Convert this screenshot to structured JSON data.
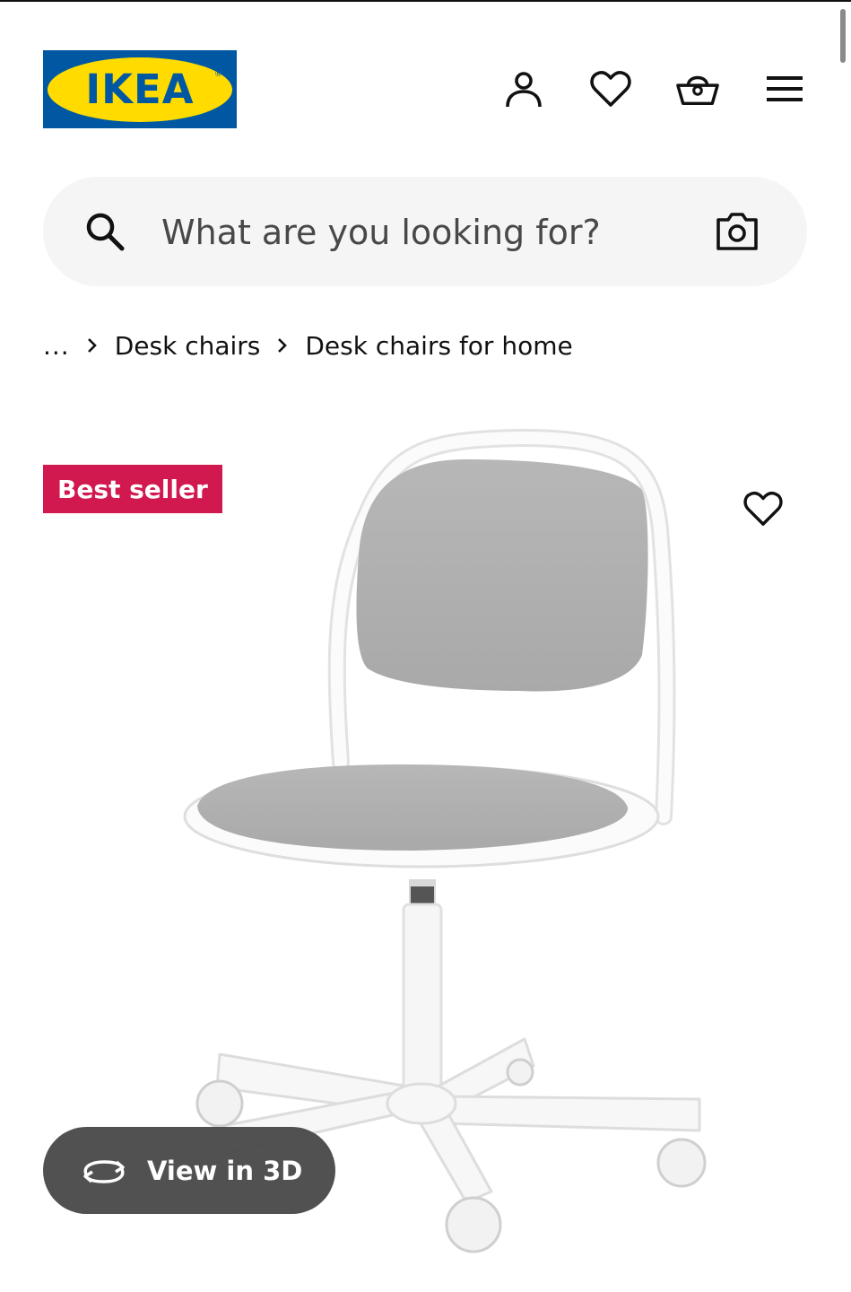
{
  "brand": {
    "logo_text": "IKEA",
    "colors": {
      "blue": "#0058a3",
      "yellow": "#ffdb00",
      "badge": "#d1184f"
    }
  },
  "header": {
    "icons": [
      "account-icon",
      "heart-icon",
      "shopping-basket-icon",
      "menu-icon"
    ]
  },
  "search": {
    "placeholder": "What are you looking for?",
    "icon": "search-icon",
    "camera_icon": "camera-icon"
  },
  "breadcrumb": {
    "items": [
      "...",
      "Desk chairs",
      "Desk chairs for home"
    ]
  },
  "product": {
    "badge": "Best seller",
    "image_alt": "White swivel desk chair with light grey seat and back",
    "view_3d_label": "View in 3D"
  }
}
